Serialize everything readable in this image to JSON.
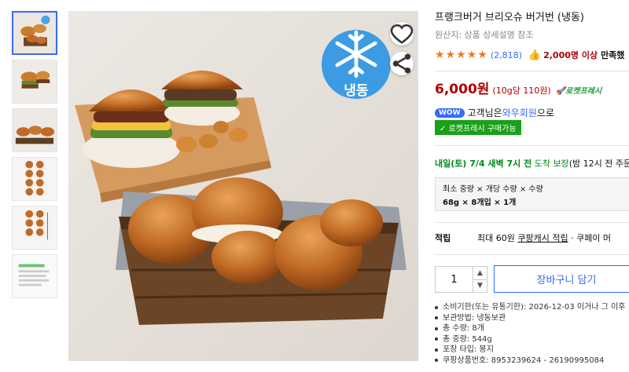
{
  "product": {
    "title": "프랭크버거 브리오슈 버거번 (냉동)",
    "origin": "원산지: 상품 상세설명 참조",
    "review_count": "(2,818)",
    "buyers": "2,000명 이상",
    "buyers_suffix": "만족했",
    "rating_stars": 5,
    "price": "6,000원",
    "unit_price": "(10g당 110원)",
    "rocket_label": "로켓프레시",
    "frozen_badge": "냉동"
  },
  "wow": {
    "badge": "WOW",
    "text_prefix": "고객님은 ",
    "link": "와우회원",
    "text_suffix": "으로",
    "green_badge": "✓ 로켓프레시 구매가능"
  },
  "delivery": {
    "date": "내일(토) 7/4 새벽 7시 전",
    "arrive": " 도착 보장",
    "note": "(밤 12시 전 주문"
  },
  "option": {
    "label": "최소 중량 × 개당 수량 × 수량",
    "value": "68g × 8개입 × 1개"
  },
  "points": {
    "label": "적립",
    "prefix": "최대 60원 ",
    "link": "쿠팡캐시 적립",
    "suffix": " · 쿠페이 머"
  },
  "purchase": {
    "quantity": "1",
    "cart_label": "장바구니 담기"
  },
  "specs": [
    "소비기한(또는 유통기한): 2026-12-03 이거나 그 이후",
    "보관방법: 냉동보관",
    "총 수량: 8개",
    "총 중량: 544g",
    "포장 타입: 봉지",
    "쿠팡상품번호: 8953239624 - 26190995084"
  ],
  "colors": {
    "accent_blue": "#346aff",
    "price_red": "#ae0000",
    "rocket_green": "#1e9a3b",
    "star_orange": "#f27a1a"
  }
}
